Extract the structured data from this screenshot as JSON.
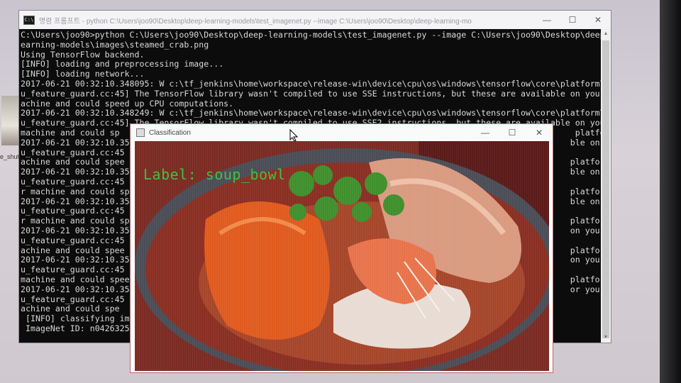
{
  "desktop": {
    "icon_label": "e_shutt"
  },
  "console": {
    "title": "명령 프롬프트 - python  C:\\Users\\joo90\\Desktop\\deep-learning-models\\test_imagenet.py --image C:\\Users\\joo90\\Desktop\\deep-learning-mo",
    "lines": [
      "C:\\Users\\joo90>python C:\\Users\\joo90\\Desktop\\deep-learning-models\\test_imagenet.py --image C:\\Users\\joo90\\Desktop\\deep-l",
      "earning-models\\images\\steamed_crab.png",
      "Using TensorFlow backend.",
      "[INFO] loading and preprocessing image...",
      "[INFO] loading network...",
      "2017-06-21 00:32:10.348095: W c:\\tf_jenkins\\home\\workspace\\release-win\\device\\cpu\\os\\windows\\tensorflow\\core\\platform\\cpu",
      "u_feature_guard.cc:45] The TensorFlow library wasn't compiled to use SSE instructions, but these are available on your m",
      "achine and could speed up CPU computations.",
      "2017-06-21 00:32:10.348249: W c:\\tf_jenkins\\home\\workspace\\release-win\\device\\cpu\\os\\windows\\tensorflow\\core\\platform\\cpu",
      "u_feature_guard.cc:45] The TensorFlow library wasn't compiled to use SSE2 instructions, but these are available on your",
      "machine and could sp                                                                                            platform\\cpu",
      "2017-06-21 00:32:10.35                                                                                         ble on your",
      "u_feature_guard.cc:45",
      "achine and could spee                                                                                          platform\\cpu",
      "2017-06-21 00:32:10.35                                                                                         ble on your",
      "u_feature_guard.cc:45",
      "r machine and could sp                                                                                         platform\\cpu",
      "2017-06-21 00:32:10.35                                                                                         ble on your",
      "u_feature_guard.cc:45",
      "r machine and could sp                                                                                         platform\\cpu",
      "2017-06-21 00:32:10.35                                                                                         on your m",
      "u_feature_guard.cc:45",
      "achine and could spee                                                                                          platform\\cpu",
      "2017-06-21 00:32:10.35                                                                                         on your m",
      "u_feature_guard.cc:45",
      "machine and could spee                                                                                         platform\\cpu",
      "2017-06-21 00:32:10.35                                                                                         or your m",
      "u_feature_guard.cc:45",
      "achine and could spe",
      " [INFO] classifying ima",
      " ImageNet ID: n0426325"
    ]
  },
  "classification": {
    "title": "Classification",
    "label": "Label: soup_bowl"
  },
  "buttons": {
    "minimize": "—",
    "maximize": "☐",
    "close": "✕"
  }
}
